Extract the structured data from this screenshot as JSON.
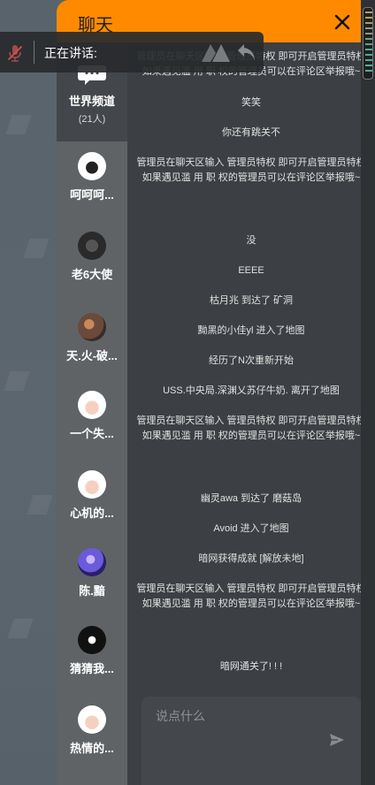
{
  "panel": {
    "title": "聊天",
    "accent_color": "#ff8a00",
    "close_icon": "close-icon"
  },
  "voice_bar": {
    "label": "正在讲话:",
    "mic_icon": "mic-muted-icon",
    "undo_icon": "undo-icon"
  },
  "world_channel": {
    "label": "世界频道",
    "count": "(21人)"
  },
  "users": [
    {
      "name": "呵呵呵..."
    },
    {
      "name": "老6大使"
    },
    {
      "name": "天.火-破..."
    },
    {
      "name": "一个失..."
    },
    {
      "name": "心机的..."
    },
    {
      "name": "陈.黯"
    },
    {
      "name": "猜猜我..."
    },
    {
      "name": "热情的..."
    }
  ],
  "messages": [
    {
      "text": "管理员在聊天区输入 管理员特权 即可开启管理员特权\n如果遇见滥 用 职 权的管理员可以在评论区举报哦~"
    },
    {
      "text": "笑笑"
    },
    {
      "text": "你还有跳关不"
    },
    {
      "text": "管理员在聊天区输入 管理员特权 即可开启管理员特权\n如果遇见滥 用 职 权的管理员可以在评论区举报哦~"
    },
    {
      "text": "没"
    },
    {
      "text": "EEEE"
    },
    {
      "text": "枯月兆 到达了 矿洞"
    },
    {
      "text": "黝黑的小佳yl 进入了地图"
    },
    {
      "text": "经历了N次重新开始"
    },
    {
      "text": "USS.中央局.深渊乂苏仔牛奶. 离开了地图"
    },
    {
      "text": "管理员在聊天区输入 管理员特权 即可开启管理员特权\n如果遇见滥 用 职 权的管理员可以在评论区举报哦~"
    },
    {
      "text": "幽灵awa 到达了 磨菇岛"
    },
    {
      "text": "Avoid 进入了地图"
    },
    {
      "text": "暗网获得成就 [解放未地]"
    },
    {
      "text": "管理员在聊天区输入 管理员特权 即可开启管理员特权\n如果遇见滥 用 职 权的管理员可以在评论区举报哦~"
    },
    {
      "text": "暗网通关了! ! !"
    }
  ],
  "input": {
    "placeholder": "说点什么",
    "send_icon": "send-icon"
  }
}
